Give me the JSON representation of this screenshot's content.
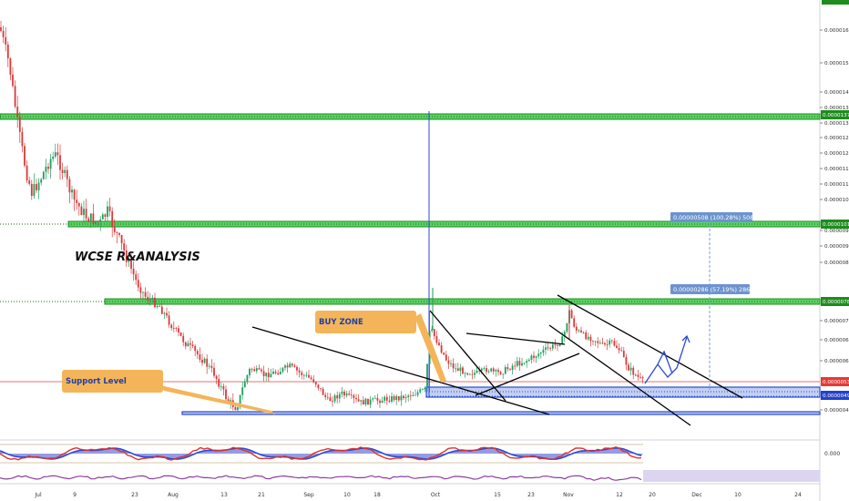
{
  "chart_data": {
    "type": "candlestick",
    "watermark": "WCSE R&ANALYSIS",
    "price_axis": {
      "ticks": [
        {
          "label": "0.00001650",
          "value": 1.65e-05
        },
        {
          "label": "0.00001500",
          "value": 1.5e-05
        },
        {
          "label": "0.00001400",
          "value": 1.4e-05
        },
        {
          "label": "0.00001350",
          "value": 1.35e-05
        },
        {
          "label": "0.00001300",
          "value": 1.3e-05
        },
        {
          "label": "0.00001250",
          "value": 1.25e-05
        },
        {
          "label": "0.00001200",
          "value": 1.2e-05
        },
        {
          "label": "0.00001150",
          "value": 1.15e-05
        },
        {
          "label": "0.00001100",
          "value": 1.1e-05
        },
        {
          "label": "0.00001050",
          "value": 1.05e-05
        },
        {
          "label": "0.00000950",
          "value": 9.5e-06
        },
        {
          "label": "0.00000900",
          "value": 9e-06
        },
        {
          "label": "0.00000840",
          "value": 8.4e-06
        },
        {
          "label": "0.00000720",
          "value": 7.2e-06
        },
        {
          "label": "0.00000660",
          "value": 6.6e-06
        },
        {
          "label": "0.00000600",
          "value": 6e-06
        },
        {
          "label": "0.00000450",
          "value": 4.5e-06
        }
      ],
      "markers": [
        {
          "label": "0.00001374",
          "value": 1.374e-05,
          "color": "#1e8c1e"
        },
        {
          "label": "0.00001016",
          "value": 1.016e-05,
          "color": "#1e8c1e"
        },
        {
          "label": "0.00000781",
          "value": 7.81e-06,
          "color": "#1e8c1e"
        },
        {
          "label": "0.00000534",
          "value": 5.34e-06,
          "color": "#e53935"
        },
        {
          "label": "0.00000491",
          "value": 4.91e-06,
          "color": "#2441c9"
        }
      ]
    },
    "time_axis": [
      "Jul",
      "9",
      "23",
      "Aug",
      "13",
      "21",
      "Sep",
      "10",
      "18",
      "Oct",
      "15",
      "23",
      "Nov",
      "12",
      "20",
      "Dec",
      "10",
      "24"
    ],
    "support_lines": [
      1.374e-05,
      1.016e-05,
      7.81e-06
    ],
    "buy_zone": [
      4.9e-06,
      5.1e-06
    ],
    "current_price": 5.34e-06,
    "annotations": {
      "buy_zone": "BUY ZONE",
      "support_level": "Support Level",
      "measure_1": "0.00000508 (100.28%) 508",
      "measure_2": "0.00000286 (57.19%) 286"
    },
    "oscillator_tick": "0.000",
    "colors": {
      "up": "#1e9e5e",
      "down": "#d93a3a",
      "support": "#59d163",
      "support_edge": "#1e8c1e",
      "zone": "#2b4bd4",
      "callout": "#f4b55a",
      "measure": "#7aa0d6"
    }
  }
}
